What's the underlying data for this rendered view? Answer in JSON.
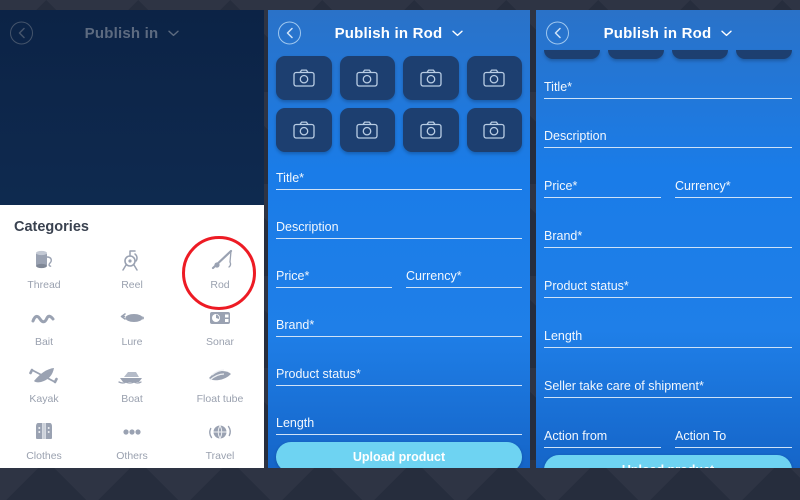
{
  "theme": {
    "backdrop": "#262d3d",
    "panel1_bg": "#0e2647",
    "panel_blue": "#1a7ce8",
    "tile_bg": "#1d3f70",
    "upload_btn": "#6ed3f2",
    "highlight_ring": "#ed1b24",
    "sheet_bg": "#ffffff"
  },
  "panel1": {
    "header": {
      "title": "Publish in",
      "back_icon": "chevron-left-icon",
      "caret_icon": "chevron-down-icon"
    },
    "sheet": {
      "title": "Categories",
      "categories": [
        {
          "label": "Thread",
          "icon": "thread-spool-icon"
        },
        {
          "label": "Reel",
          "icon": "fishing-reel-icon"
        },
        {
          "label": "Rod",
          "icon": "fishing-rod-icon",
          "highlighted": true
        },
        {
          "label": "Bait",
          "icon": "worm-bait-icon"
        },
        {
          "label": "Lure",
          "icon": "fishing-lure-icon"
        },
        {
          "label": "Sonar",
          "icon": "sonar-device-icon"
        },
        {
          "label": "Kayak",
          "icon": "kayak-icon"
        },
        {
          "label": "Boat",
          "icon": "boat-icon"
        },
        {
          "label": "Float tube",
          "icon": "float-tube-icon"
        },
        {
          "label": "Clothes",
          "icon": "life-vest-icon"
        },
        {
          "label": "Others",
          "icon": "ellipsis-icon"
        },
        {
          "label": "Travel",
          "icon": "globe-travel-icon"
        }
      ]
    }
  },
  "panel2": {
    "header": {
      "title": "Publish in Rod",
      "back_icon": "chevron-left-icon",
      "caret_icon": "chevron-down-icon"
    },
    "photo_tiles": [
      {
        "icon": "camera-icon"
      },
      {
        "icon": "camera-icon"
      },
      {
        "icon": "camera-icon"
      },
      {
        "icon": "camera-icon"
      },
      {
        "icon": "camera-icon"
      },
      {
        "icon": "camera-icon"
      },
      {
        "icon": "camera-icon"
      },
      {
        "icon": "camera-icon"
      }
    ],
    "fields": [
      {
        "label": "Title*",
        "value": ""
      },
      {
        "label": "Description",
        "value": ""
      },
      {
        "label": "Price*",
        "value": ""
      },
      {
        "label": "Currency*",
        "value": ""
      },
      {
        "label": "Brand*",
        "value": ""
      },
      {
        "label": "Product status*",
        "value": ""
      },
      {
        "label": "Length",
        "value": ""
      }
    ],
    "upload_label": "Upload product"
  },
  "panel3": {
    "header": {
      "title": "Publish in Rod",
      "back_icon": "chevron-left-icon",
      "caret_icon": "chevron-down-icon"
    },
    "scrolled": true,
    "fields": [
      {
        "label": "Title*",
        "value": ""
      },
      {
        "label": "Description",
        "value": ""
      },
      {
        "label": "Price*",
        "value": ""
      },
      {
        "label": "Currency*",
        "value": ""
      },
      {
        "label": "Brand*",
        "value": ""
      },
      {
        "label": "Product status*",
        "value": ""
      },
      {
        "label": "Length",
        "value": ""
      },
      {
        "label": "Seller take care of shipment*",
        "value": ""
      },
      {
        "label": "Action from",
        "value": ""
      },
      {
        "label": "Action To",
        "value": ""
      }
    ],
    "upload_label": "Upload product"
  }
}
